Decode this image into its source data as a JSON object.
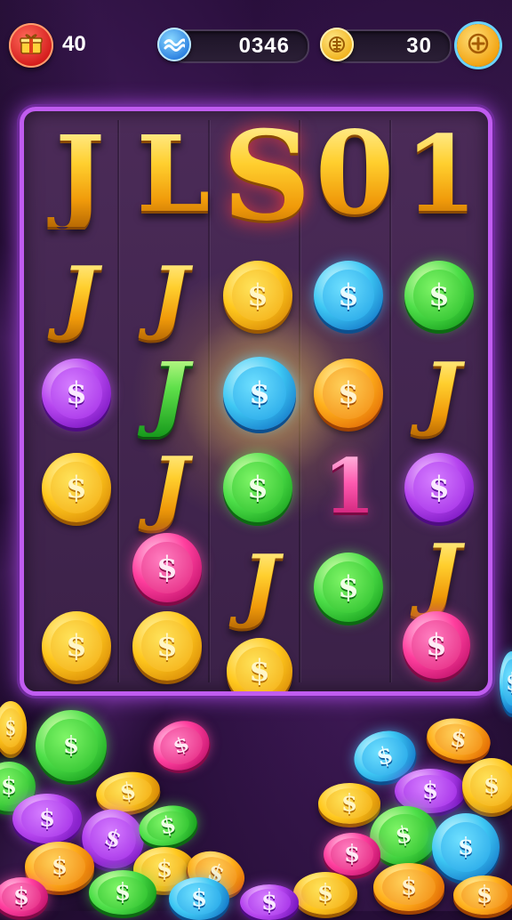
{
  "topbar": {
    "gift_count": "40",
    "gems_value": "0346",
    "coins_value": "30",
    "gift_icon": "gift-icon",
    "gems_icon": "wave-gem-icon",
    "coins_icon": "gold-coin-icon",
    "add_icon": "plus-icon"
  },
  "board": {
    "title_letters": [
      "J",
      "L",
      "S",
      "0",
      "1"
    ],
    "rows": [
      [
        "J",
        "J",
        "$",
        "$",
        "$"
      ],
      [
        "$",
        "J",
        "$",
        "$",
        "J"
      ],
      [
        "$",
        "J",
        "$",
        "1",
        "$"
      ],
      [
        "",
        "$",
        "J",
        "$",
        "J"
      ],
      [
        "$",
        "$",
        "$",
        "",
        "$"
      ]
    ],
    "coin_symbol": "$"
  },
  "colors": {
    "frame": "#c05cf0",
    "gold": "#ffc81e",
    "blue": "#3ec8f4",
    "green": "#4fe04a",
    "purple": "#b747f0",
    "pink": "#ff3f9e",
    "orange": "#ffb01c"
  }
}
